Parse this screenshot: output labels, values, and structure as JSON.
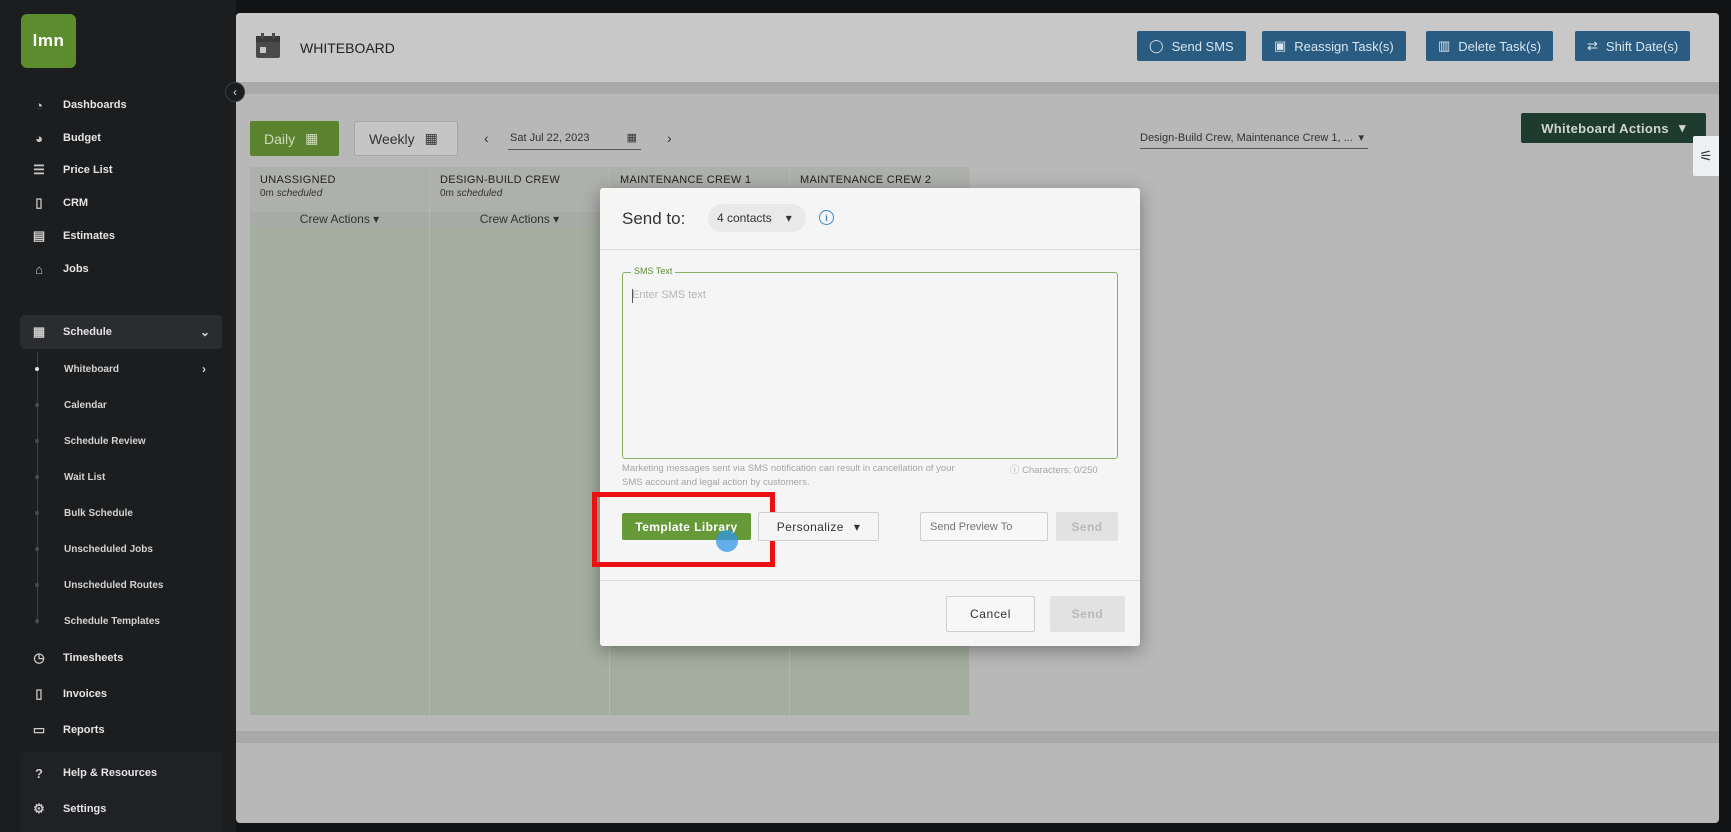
{
  "app": {
    "logo_text": "lmn"
  },
  "sidebar": {
    "items": [
      {
        "label": "Dashboards",
        "icon": "gauge-icon"
      },
      {
        "label": "Budget",
        "icon": "pie-chart-icon"
      },
      {
        "label": "Price List",
        "icon": "list-icon"
      },
      {
        "label": "CRM",
        "icon": "contact-card-icon"
      },
      {
        "label": "Estimates",
        "icon": "calculator-icon"
      },
      {
        "label": "Jobs",
        "icon": "garage-icon"
      },
      {
        "label": "Schedule",
        "icon": "calendar-icon"
      }
    ],
    "schedule_sub": [
      "Whiteboard",
      "Calendar",
      "Schedule Review",
      "Wait List",
      "Bulk Schedule",
      "Unscheduled Jobs",
      "Unscheduled Routes",
      "Schedule Templates"
    ],
    "bottom_items": [
      {
        "label": "Timesheets",
        "icon": "clock-icon"
      },
      {
        "label": "Invoices",
        "icon": "invoice-icon"
      },
      {
        "label": "Reports",
        "icon": "report-icon"
      },
      {
        "label": "Help & Resources",
        "icon": "help-icon"
      },
      {
        "label": "Settings",
        "icon": "gear-icon"
      }
    ]
  },
  "header": {
    "title": "WHITEBOARD",
    "buttons": {
      "send_sms": "Send SMS",
      "reassign": "Reassign Task(s)",
      "delete": "Delete Task(s)",
      "shift": "Shift Date(s)"
    }
  },
  "toolbar": {
    "daily": "Daily",
    "weekly": "Weekly",
    "date": "Sat Jul 22, 2023",
    "crew_select": "Design-Build Crew, Maintenance Crew 1, ...",
    "whiteboard_actions": "Whiteboard Actions"
  },
  "crews": [
    {
      "name": "UNASSIGNED",
      "hours": "0m",
      "sched": "scheduled",
      "actions": "Crew Actions"
    },
    {
      "name": "DESIGN-BUILD CREW",
      "hours": "0m",
      "sched": "scheduled",
      "actions": "Crew Actions"
    },
    {
      "name": "MAINTENANCE CREW 1"
    },
    {
      "name": "MAINTENANCE CREW 2"
    }
  ],
  "modal": {
    "send_to_label": "Send to:",
    "contacts": "4 contacts",
    "sms_label": "SMS Text",
    "sms_placeholder": "Enter SMS text",
    "sms_value": "",
    "warning": "Marketing messages sent via SMS notification can result in cancellation of your SMS account and legal action by customers.",
    "char_count": "Characters: 0/250",
    "template_library": "Template Library",
    "personalize": "Personalize",
    "preview_placeholder": "Send Preview To",
    "send_small": "Send",
    "cancel": "Cancel",
    "send": "Send"
  },
  "colors": {
    "brand_green": "#5d8c2f",
    "header_blue": "#2a5b80",
    "highlight_red": "#ec1010"
  }
}
